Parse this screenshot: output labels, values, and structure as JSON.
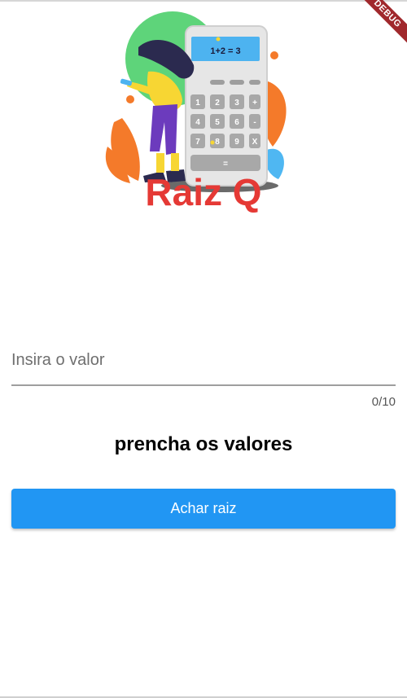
{
  "debug_banner": {
    "label": "DEBUG"
  },
  "logo": {
    "title": "Raiz Q",
    "calculator_display": "1+2      = 3",
    "keys": [
      "1",
      "2",
      "3",
      "+",
      "4",
      "5",
      "6",
      "-",
      "7",
      "8",
      "9",
      "X",
      "="
    ],
    "accent_color": "#e53935"
  },
  "input": {
    "placeholder": "Insira o valor",
    "value": "",
    "counter": "0/10"
  },
  "message": "prencha os valores",
  "button": {
    "label": "Achar raiz",
    "color": "#2196f3"
  }
}
